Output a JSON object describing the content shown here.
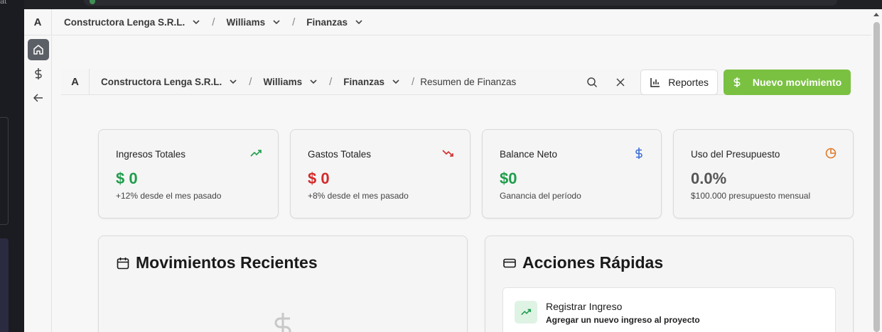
{
  "os": {
    "fragment": "at"
  },
  "topbar": {
    "logo": "A",
    "crumbs": [
      "Constructora Lenga S.R.L.",
      "Williams",
      "Finanzas"
    ],
    "separator": "/"
  },
  "subbar": {
    "logo": "A",
    "crumbs": [
      "Constructora Lenga S.R.L.",
      "Williams",
      "Finanzas"
    ],
    "current": "Resumen de Finanzas",
    "separator": "/",
    "reportes_label": "Reportes",
    "nuevo_label": "Nuevo movimiento"
  },
  "stats": [
    {
      "title": "Ingresos Totales",
      "value": "$ 0",
      "sub": "+12% desde el mes pasado",
      "color": "#1f9d4c",
      "icon": "trending-up-icon"
    },
    {
      "title": "Gastos Totales",
      "value": "$ 0",
      "sub": "+8% desde el mes pasado",
      "color": "#d42a2a",
      "icon": "trending-down-icon"
    },
    {
      "title": "Balance Neto",
      "value": "$0",
      "sub": "Ganancia del período",
      "color": "#1f9d4c",
      "icon": "dollar-icon"
    },
    {
      "title": "Uso del Presupuesto",
      "value": "0.0%",
      "sub": "$100.000 presupuesto mensual",
      "color": "#555555",
      "icon": "pie-chart-icon"
    }
  ],
  "recent": {
    "title": "Movimientos Recientes"
  },
  "actions": {
    "title": "Acciones Rápidas",
    "items": [
      {
        "title": "Registrar Ingreso",
        "desc": "Agregar un nuevo ingreso al proyecto"
      }
    ]
  },
  "colors": {
    "accent_green": "#7ac142",
    "income": "#1f9d4c",
    "expense": "#d42a2a",
    "balance_icon": "#3b6fd8",
    "budget_icon": "#e07a2a"
  }
}
